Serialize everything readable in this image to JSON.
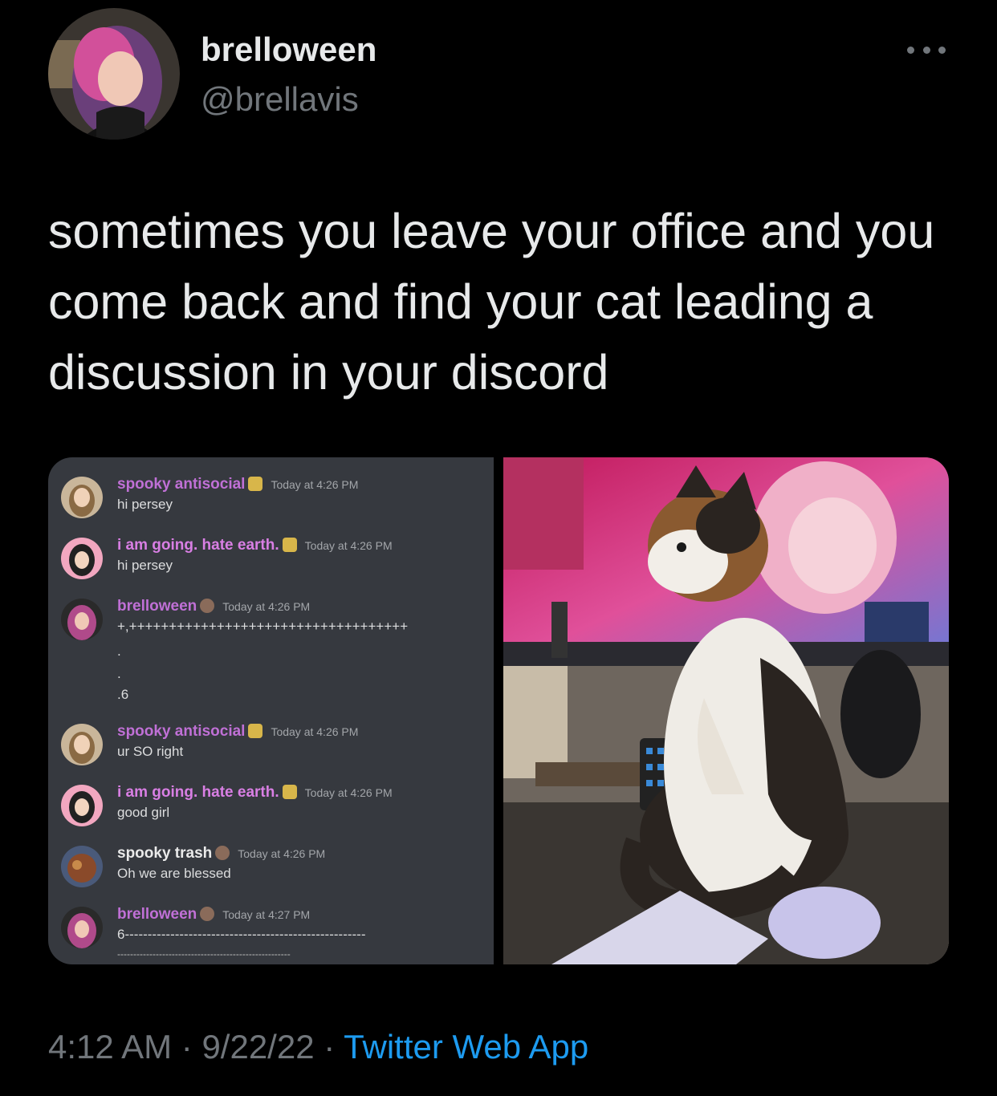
{
  "author": {
    "display_name": "brelloween",
    "handle": "@brellavis"
  },
  "tweet": {
    "text": "sometimes you leave your office and you come back and find your cat leading a discussion in your discord"
  },
  "meta": {
    "time": "4:12 AM",
    "sep1": " · ",
    "date": "9/22/22",
    "sep2": " · ",
    "source": "Twitter Web App"
  },
  "discord": {
    "messages": [
      {
        "user": "spooky antisocial",
        "time": "Today at 4:26 PM",
        "text": "hi persey"
      },
      {
        "user": "i am going. hate earth.",
        "time": "Today at 4:26 PM",
        "text": "hi persey"
      },
      {
        "user": "brelloween",
        "time": "Today at 4:26 PM",
        "text": "+,+++++++++++++++++++++++++++++++++++"
      },
      {
        "user": "spooky antisocial",
        "time": "Today at 4:26 PM",
        "text": "ur SO right"
      },
      {
        "user": "i am going. hate earth.",
        "time": "Today at 4:26 PM",
        "text": "good girl"
      },
      {
        "user": "spooky trash",
        "time": "Today at 4:26 PM",
        "text": "Oh we are blessed"
      },
      {
        "user": "brelloween",
        "time": "Today at 4:27 PM",
        "text": "6-----------------------------------------------------"
      }
    ],
    "stray_lines": [
      ".",
      ".",
      ".6"
    ],
    "trailing_line": "------------------------------------------------------"
  },
  "colors": {
    "background": "#000000",
    "text": "#e7e9ea",
    "muted": "#71767b",
    "link": "#1d9bf0",
    "discord_bg": "#36393f",
    "username_pink": "#c070d6"
  },
  "icons": {
    "more": "more-horizontal-icon"
  }
}
